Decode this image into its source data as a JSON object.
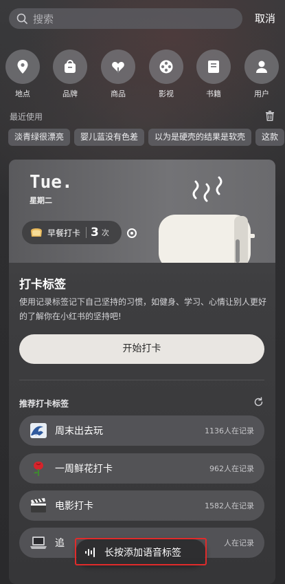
{
  "search": {
    "placeholder": "搜索",
    "cancel_label": "取消"
  },
  "categories": [
    {
      "label": "地点",
      "icon": "location-pin-icon"
    },
    {
      "label": "品牌",
      "icon": "shopping-bag-icon"
    },
    {
      "label": "商品",
      "icon": "heart-tag-icon"
    },
    {
      "label": "影视",
      "icon": "film-reel-icon"
    },
    {
      "label": "书籍",
      "icon": "book-icon"
    },
    {
      "label": "用户",
      "icon": "user-icon"
    }
  ],
  "recent": {
    "title": "最近使用",
    "chips": [
      "淡青绿很漂亮",
      "婴儿蓝没有色差",
      "以为是硬壳的结果是软壳",
      "这款"
    ]
  },
  "checkin": {
    "day": "Tue.",
    "weekday": "星期二",
    "pill_name": "早餐打卡",
    "pill_count": "3",
    "pill_unit": "次",
    "title": "打卡标签",
    "description": "使用记录标签记下自己坚持的习惯，如健身、学习、心情让别人更好的了解你在小红书的坚持吧!",
    "start_label": "开始打卡",
    "recommend_title": "推荐打卡标签",
    "tags": [
      {
        "name": "周末出去玩",
        "count": "1136人在记录",
        "icon": "wave-emoji-icon"
      },
      {
        "name": "一周鲜花打卡",
        "count": "962人在记录",
        "icon": "rose-emoji-icon"
      },
      {
        "name": "电影打卡",
        "count": "1582人在记录",
        "icon": "clapper-emoji-icon"
      },
      {
        "name": "追",
        "count": "人在记录",
        "icon": "laptop-emoji-icon"
      }
    ]
  },
  "voice": {
    "label": "长按添加语音标签"
  }
}
